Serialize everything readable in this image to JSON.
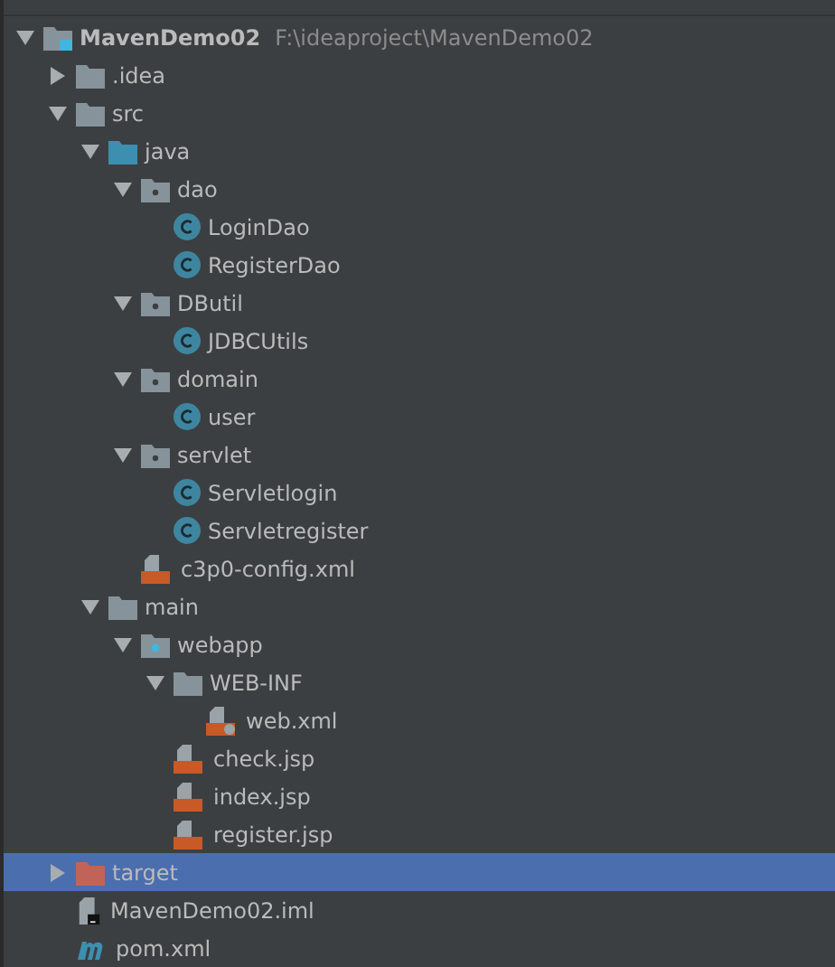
{
  "tree": [
    {
      "name": "MavenDemo02",
      "path": "F:\\ideaproject\\MavenDemo02",
      "kind": "module",
      "expanded": true,
      "selected": false,
      "children": [
        {
          "name": ".idea",
          "kind": "folder",
          "expanded": false,
          "selected": false
        },
        {
          "name": "src",
          "kind": "folder",
          "expanded": true,
          "selected": false,
          "children": [
            {
              "name": "java",
              "kind": "source",
              "expanded": true,
              "selected": false,
              "children": [
                {
                  "name": "dao",
                  "kind": "package",
                  "expanded": true,
                  "selected": false,
                  "children": [
                    {
                      "name": "LoginDao",
                      "kind": "class",
                      "selected": false
                    },
                    {
                      "name": "RegisterDao",
                      "kind": "class",
                      "selected": false
                    }
                  ]
                },
                {
                  "name": "DButil",
                  "kind": "package",
                  "expanded": true,
                  "selected": false,
                  "children": [
                    {
                      "name": "JDBCUtils",
                      "kind": "class",
                      "selected": false
                    }
                  ]
                },
                {
                  "name": "domain",
                  "kind": "package",
                  "expanded": true,
                  "selected": false,
                  "children": [
                    {
                      "name": "user",
                      "kind": "class",
                      "selected": false
                    }
                  ]
                },
                {
                  "name": "servlet",
                  "kind": "package",
                  "expanded": true,
                  "selected": false,
                  "children": [
                    {
                      "name": "Servletlogin",
                      "kind": "class",
                      "selected": false
                    },
                    {
                      "name": "Servletregister",
                      "kind": "class",
                      "selected": false
                    }
                  ]
                },
                {
                  "name": "c3p0-config.xml",
                  "kind": "xml",
                  "selected": false
                }
              ]
            },
            {
              "name": "main",
              "kind": "folder",
              "expanded": true,
              "selected": false,
              "children": [
                {
                  "name": "webapp",
                  "kind": "web",
                  "expanded": true,
                  "selected": false,
                  "children": [
                    {
                      "name": "WEB-INF",
                      "kind": "folder",
                      "expanded": true,
                      "selected": false,
                      "children": [
                        {
                          "name": "web.xml",
                          "kind": "webxml",
                          "selected": false
                        }
                      ]
                    },
                    {
                      "name": "check.jsp",
                      "kind": "jsp",
                      "selected": false
                    },
                    {
                      "name": "index.jsp",
                      "kind": "jsp",
                      "selected": false
                    },
                    {
                      "name": "register.jsp",
                      "kind": "jsp",
                      "selected": false
                    }
                  ]
                }
              ]
            }
          ]
        },
        {
          "name": "target",
          "kind": "excluded",
          "expanded": false,
          "selected": true
        },
        {
          "name": "MavenDemo02.iml",
          "kind": "iml",
          "selected": false
        },
        {
          "name": "pom.xml",
          "kind": "maven",
          "selected": false
        }
      ]
    }
  ]
}
